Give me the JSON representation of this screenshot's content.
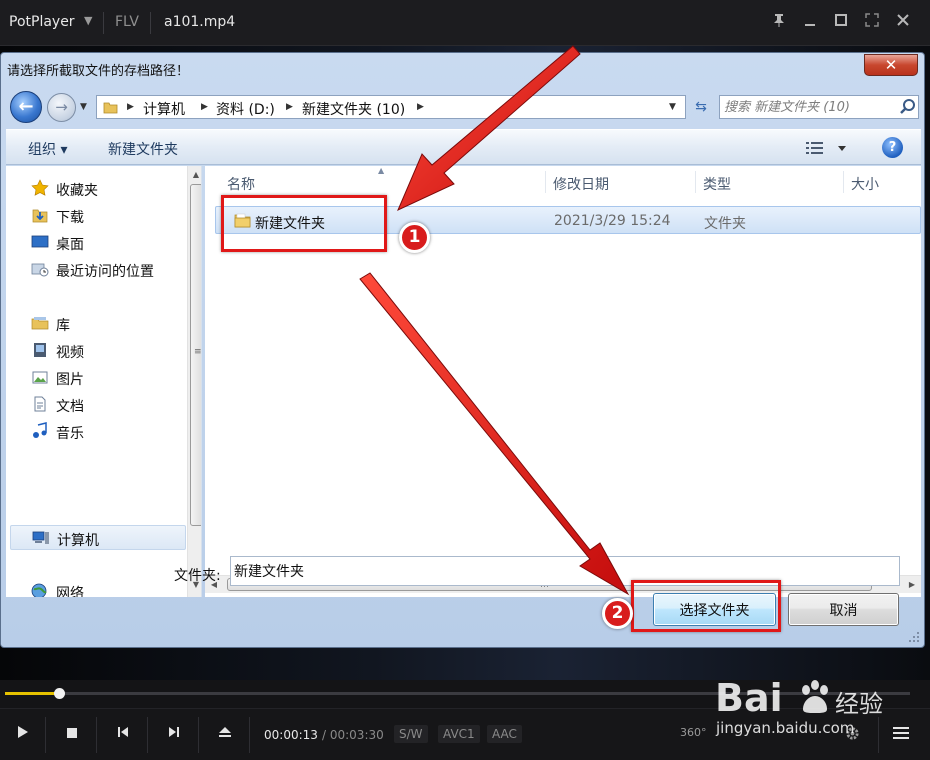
{
  "player": {
    "logo": "PotPlayer",
    "format": "FLV",
    "filename": "a101.mp4",
    "time_current": "00:00:13",
    "time_total": "/ 00:03:30",
    "tags": [
      "S/W",
      "AVC1",
      "AAC"
    ],
    "badge_360": "360°",
    "seek_progress": 0.06,
    "accent_color": "#e6c200"
  },
  "dialog": {
    "title": "请选择所截取文件的存档路径！",
    "breadcrumbs": [
      "计算机",
      "资料 (D:)",
      "新建文件夹 (10)"
    ],
    "search_placeholder": "搜索 新建文件夹 (10)",
    "toolbar": {
      "organize": "组织 ▾",
      "new_folder": "新建文件夹"
    },
    "nav": {
      "favorites": "收藏夹",
      "downloads": "下载",
      "desktop": "桌面",
      "recent": "最近访问的位置",
      "libraries": "库",
      "videos": "视频",
      "pictures": "图片",
      "documents": "文档",
      "music": "音乐",
      "computer": "计算机",
      "network": "网络"
    },
    "columns": {
      "name": "名称",
      "date": "修改日期",
      "type": "类型",
      "size": "大小"
    },
    "rows": [
      {
        "name": "新建文件夹",
        "date": "2021/3/29 15:24",
        "type": "文件夹"
      }
    ],
    "folder_label": "文件夹:",
    "folder_value": "新建文件夹",
    "select_button": "选择文件夹",
    "cancel_button": "取消"
  },
  "annotations": {
    "step1": "1",
    "step2": "2",
    "color": "#e01818"
  },
  "watermark": {
    "brand": "Bai",
    "brand_suffix": "经验",
    "url": "jingyan.baidu.com"
  }
}
